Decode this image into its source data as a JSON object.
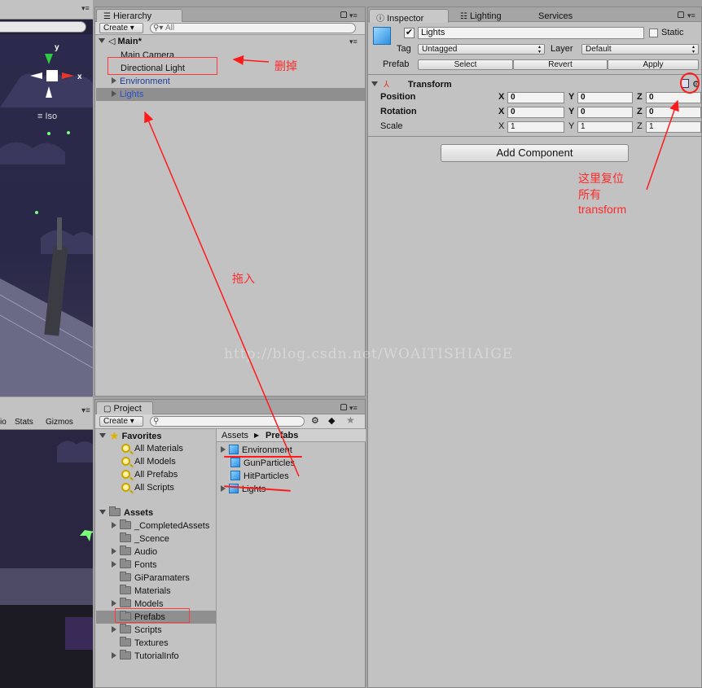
{
  "hierarchy": {
    "tab": "Hierarchy",
    "create": "Create",
    "search_placeholder": "All",
    "scene": "Main*",
    "items": [
      "Main Camera",
      "Directional Light",
      "Environment",
      "Lights"
    ]
  },
  "inspector": {
    "tabs": [
      "Inspector",
      "Lighting",
      "Services"
    ],
    "object_name": "Lights",
    "static_label": "Static",
    "tag_label": "Tag",
    "tag_value": "Untagged",
    "layer_label": "Layer",
    "layer_value": "Default",
    "prefab_label": "Prefab",
    "prefab_buttons": [
      "Select",
      "Revert",
      "Apply"
    ],
    "component": "Transform",
    "position_label": "Position",
    "rotation_label": "Rotation",
    "scale_label": "Scale",
    "axis": [
      "X",
      "Y",
      "Z"
    ],
    "position": [
      "0",
      "0",
      "0"
    ],
    "rotation": [
      "0",
      "0",
      "0"
    ],
    "scale": [
      "1",
      "1",
      "1"
    ],
    "add_component": "Add Component"
  },
  "project": {
    "tab": "Project",
    "create": "Create",
    "favorites_label": "Favorites",
    "favorites": [
      "All Materials",
      "All Models",
      "All Prefabs",
      "All Scripts"
    ],
    "assets_label": "Assets",
    "folders": [
      "_CompletedAssets",
      "_Scence",
      "Audio",
      "Fonts",
      "GiParamaters",
      "Materials",
      "Models",
      "Prefabs",
      "Scripts",
      "Textures",
      "TutorialInfo"
    ],
    "breadcrumb_root": "Assets",
    "breadcrumb_current": "Prefabs",
    "prefabs": [
      "Environment",
      "GunParticles",
      "HitParticles",
      "Lights"
    ]
  },
  "scene": {
    "iso_label": "Iso",
    "gizmo_y": "y",
    "gizmo_x": "x",
    "game_bar": [
      "io",
      "Stats",
      "Gizmos"
    ]
  },
  "annotations": {
    "delete_note": "删掉",
    "drag_note": "拖入",
    "reset_note_lines": [
      "这里复位",
      "所有",
      "transform"
    ]
  },
  "watermark": "http://blog.csdn.net/WOAITISHIAIGE",
  "colors": {
    "annotation_red": "#ff2a2a",
    "panel_bg": "#c2c2c2",
    "selection": "#8f8f8f",
    "scene_bg": "#2a2848"
  }
}
